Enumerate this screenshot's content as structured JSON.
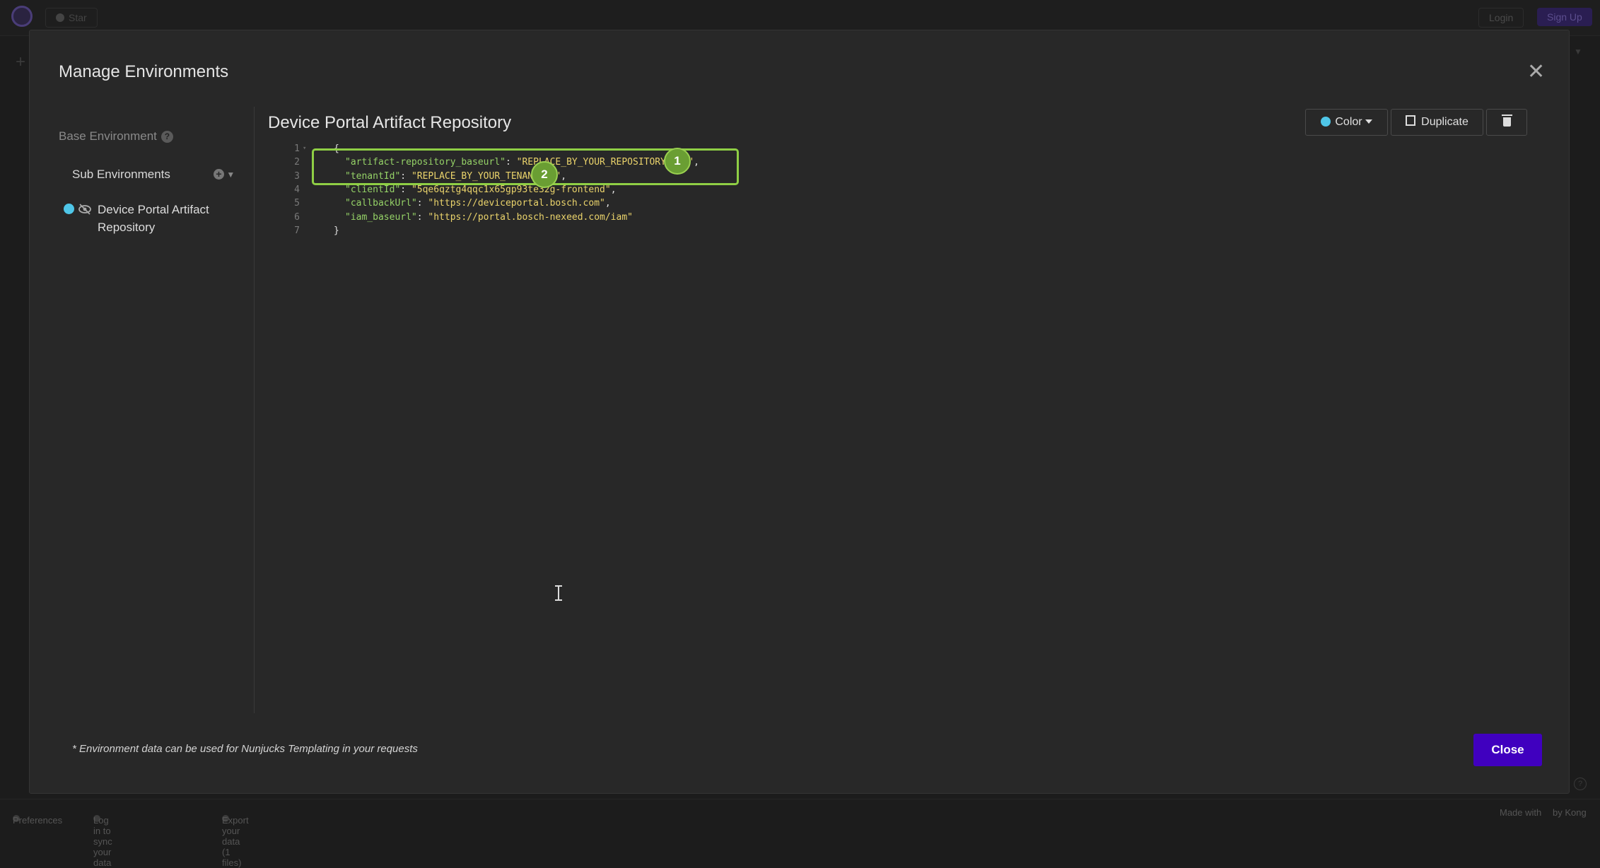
{
  "topbar": {
    "star_label": "Star",
    "login_label": "Login",
    "signup_label": "Sign Up"
  },
  "bottombar": {
    "preferences": "Preferences",
    "sync": "Log in to sync your data",
    "export": "Export your data (1 files)",
    "made_with": "Made with",
    "by_kong": "by Kong"
  },
  "modal": {
    "title": "Manage Environments",
    "close_icon": "close-icon",
    "sidebar": {
      "base_environment": "Base Environment",
      "help_glyph": "?",
      "sub_environments": "Sub Environments",
      "items": [
        {
          "label": "Device Portal Artifact Repository",
          "color": "#4fc6e8",
          "icon": "eye-slash-icon"
        }
      ]
    },
    "editor_title": "Device Portal Artifact Repository",
    "toolbar": {
      "color_label": "Color",
      "duplicate_label": "Duplicate",
      "delete_icon": "trash-icon"
    },
    "code": {
      "line_numbers": [
        "1",
        "2",
        "3",
        "4",
        "5",
        "6",
        "7"
      ],
      "open_brace": "{",
      "close_brace": "}",
      "entries": [
        {
          "key": "\"artifact-repository_baseurl\"",
          "value": "\"REPLACE_BY_YOUR_REPOSITORY_URL\"",
          "sep": ": ",
          "end": ","
        },
        {
          "key": "\"tenantId\"",
          "value": "\"REPLACE_BY_YOUR_TENANT_ID\"",
          "sep": ": ",
          "end": ","
        },
        {
          "key": "\"clientId\"",
          "value": "\"5qe6qztg4qqc1x65gp93te32g-frontend\"",
          "sep": ": ",
          "end": ","
        },
        {
          "key": "\"callbackUrl\"",
          "value": "\"https://deviceportal.bosch.com\"",
          "sep": ": ",
          "end": ","
        },
        {
          "key": "\"iam_baseurl\"",
          "value": "\"https://portal.bosch-nexeed.com/iam\"",
          "sep": ": ",
          "end": ""
        }
      ]
    },
    "annotations": {
      "badge1": "1",
      "badge2": "2",
      "highlight_color": "#8fcf45"
    },
    "footer_note": "* Environment data can be used for Nunjucks Templating in your requests",
    "close_button": "Close"
  },
  "colors": {
    "accent": "#4000bf",
    "env_color": "#4fc6e8",
    "json_key": "#95d267",
    "json_string": "#ead36b"
  }
}
